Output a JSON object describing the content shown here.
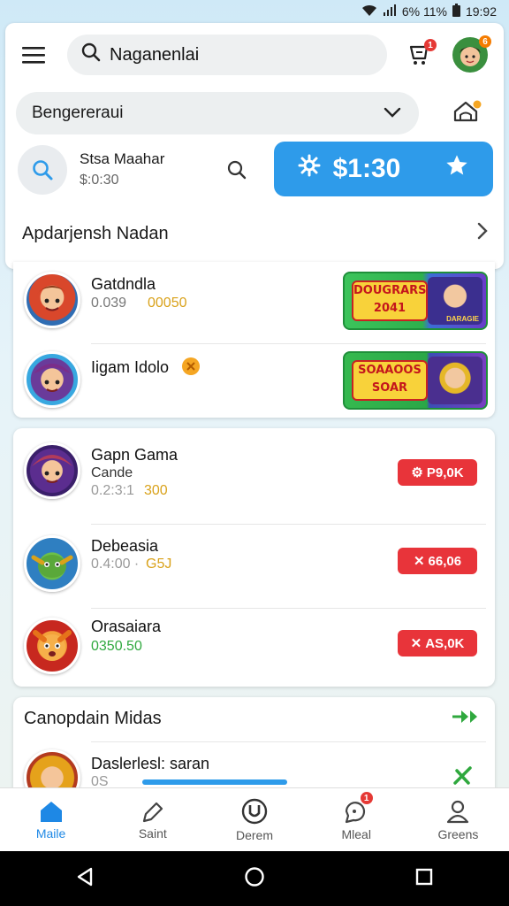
{
  "status_bar": {
    "signal": "ᯤ",
    "battery_text": "6% 11%",
    "time": "19:92"
  },
  "header": {
    "search_value": "Naganenlai",
    "cart_badge": "1",
    "avatar_badge": "6"
  },
  "selector": {
    "value": "Bengereraui"
  },
  "user": {
    "name": "Stsa Maahar",
    "sub": "$:0:30"
  },
  "balance": {
    "amount": "$1:30"
  },
  "section1": {
    "title": "Apdarjensh Nadan"
  },
  "games_top": [
    {
      "title": "Gatdndla",
      "sub_a": "0.039",
      "sub_b": "00050",
      "promo_text": "DOUGRARS 2041",
      "promo_caption": "DARAGIE"
    },
    {
      "title": "Iigam Idolo",
      "sub_a": "",
      "sub_b": "",
      "promo_text": "SOAAOOS SOAR",
      "promo_caption": ""
    }
  ],
  "games_list": [
    {
      "title": "Gapn Gama",
      "title2": "Cande",
      "sub_a": "0.2:3:1",
      "sub_b": "300",
      "chip": "P9,0K",
      "chip_icon": "⚙"
    },
    {
      "title": "Debeasia",
      "title2": "",
      "sub_a": "0.4:00 ·",
      "sub_b": "G5J",
      "chip": "66,06",
      "chip_icon": "✕"
    },
    {
      "title": "Orasaiara",
      "title2": "",
      "sub_a": "",
      "sub_b": "0350.50",
      "chip": "AS,0K",
      "chip_icon": "✕"
    }
  ],
  "section2": {
    "title": "Canopdain Midas"
  },
  "bottom_item": {
    "title": "Daslerlesl: saran",
    "sub": "0S",
    "progress": 1.0
  },
  "nav": [
    {
      "label": "Maile",
      "icon": "home-icon"
    },
    {
      "label": "Saint",
      "icon": "edit-icon"
    },
    {
      "label": "Derem",
      "icon": "u-circle-icon"
    },
    {
      "label": "Mleal",
      "icon": "chat-icon",
      "badge": "1"
    },
    {
      "label": "Greens",
      "icon": "person-icon"
    }
  ],
  "colors": {
    "accent": "#2e9bea",
    "chip_red": "#e8343a",
    "promo_green": "#3cc45b"
  }
}
